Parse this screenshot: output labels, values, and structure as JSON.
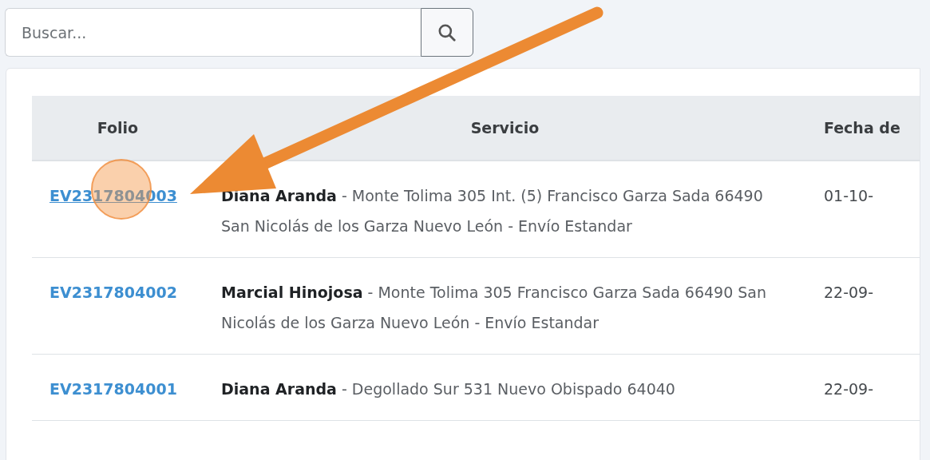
{
  "search": {
    "placeholder": "Buscar..."
  },
  "table": {
    "columns": [
      "Folio",
      "Servicio",
      "Fecha de"
    ],
    "rows": [
      {
        "folio": "EV2317804003",
        "hovered": true,
        "servicio": "**Diana Aranda** - Monte Tolima 305 Int. (5) Francisco Garza Sada 66490 San Nicolás de los Garza Nuevo León - Envío Estandar",
        "fecha": "01-10-"
      },
      {
        "folio": "EV2317804002",
        "hovered": false,
        "servicio": "**Marcial Hinojosa** - Monte Tolima 305 Francisco Garza Sada 66490 San Nicolás de los Garza Nuevo León - Envío Estandar",
        "fecha": "22-09-"
      },
      {
        "folio": "EV2317804001",
        "hovered": false,
        "servicio": "**Diana Aranda** - Degollado Sur 531 Nuevo Obispado 64040",
        "fecha": "22-09-"
      }
    ]
  }
}
